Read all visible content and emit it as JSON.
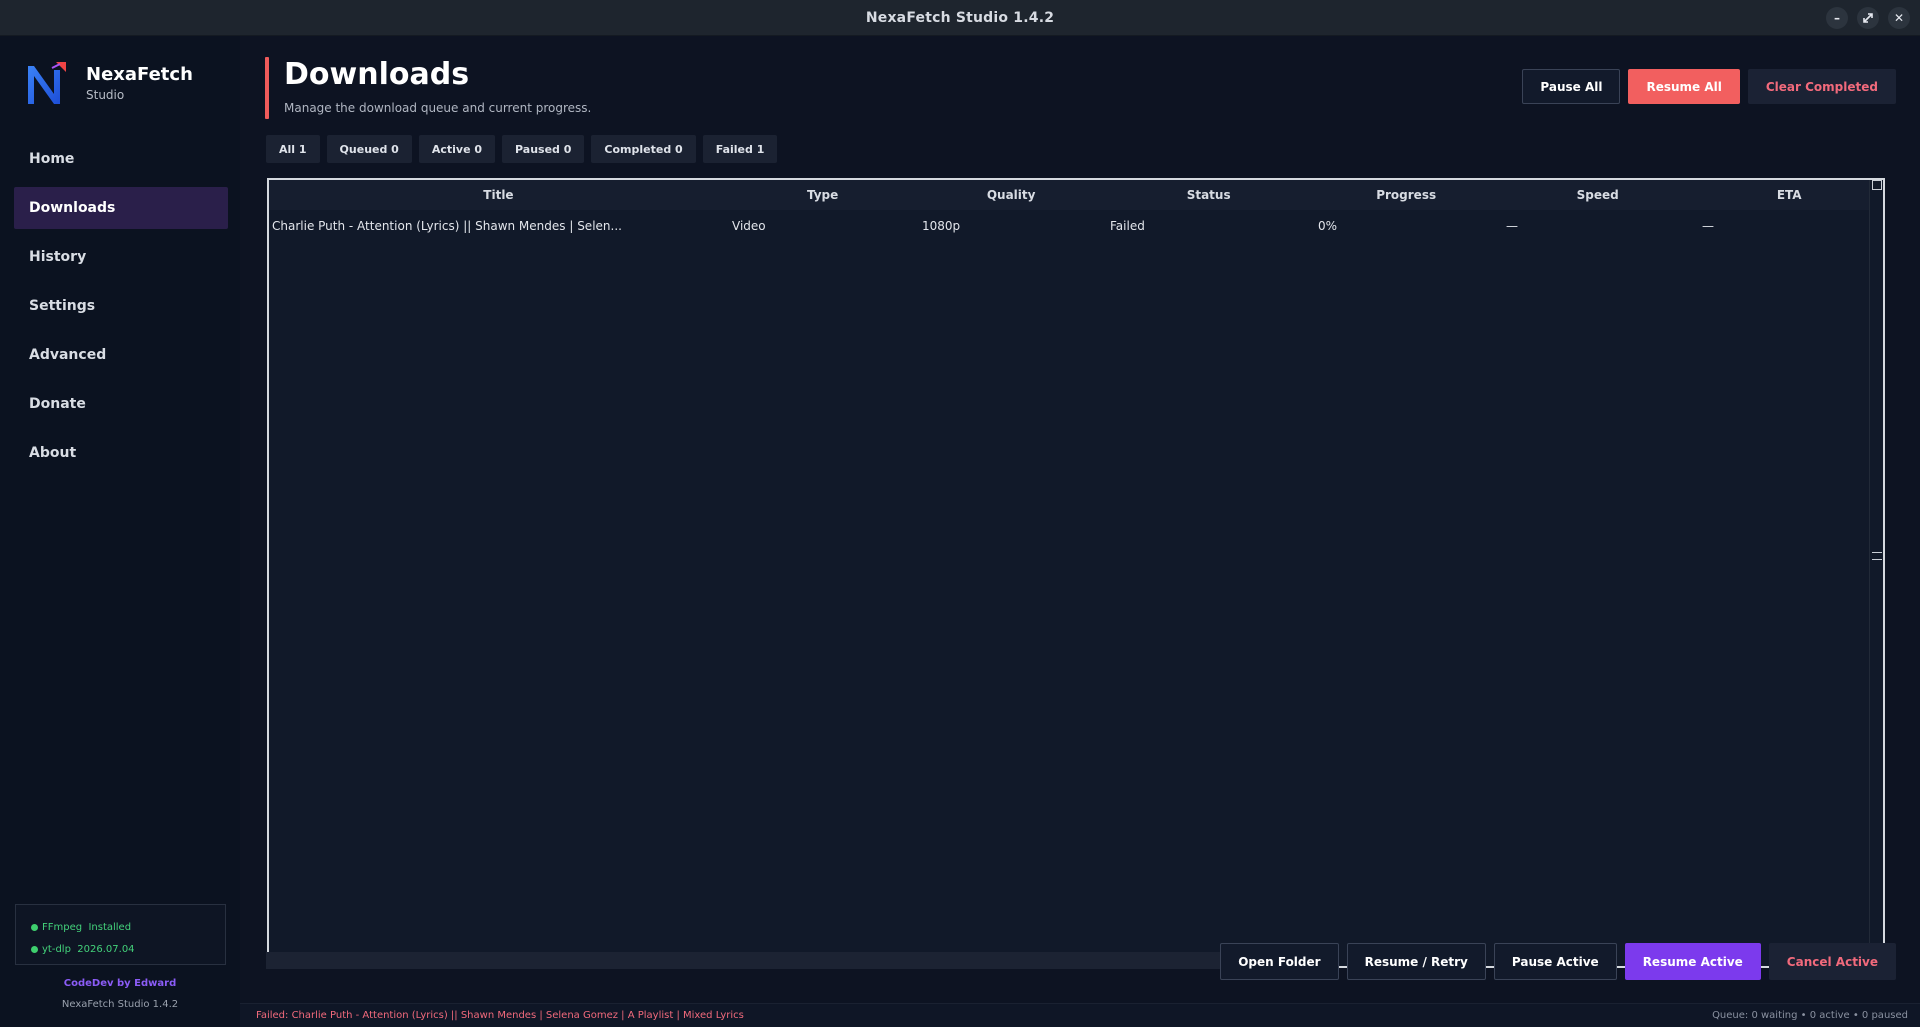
{
  "window": {
    "title": "NexaFetch Studio 1.4.2"
  },
  "sidebar": {
    "brand_name": "NexaFetch",
    "brand_sub": "Studio",
    "items": [
      {
        "label": "Home",
        "active": false
      },
      {
        "label": "Downloads",
        "active": true
      },
      {
        "label": "History",
        "active": false
      },
      {
        "label": "Settings",
        "active": false
      },
      {
        "label": "Advanced",
        "active": false
      },
      {
        "label": "Donate",
        "active": false
      },
      {
        "label": "About",
        "active": false
      }
    ],
    "deps": [
      {
        "name": "FFmpeg",
        "value": "Installed"
      },
      {
        "name": "yt-dlp",
        "value": "2026.07.04"
      }
    ],
    "credit": "CodeDev by Edward",
    "version": "NexaFetch Studio 1.4.2"
  },
  "header": {
    "title": "Downloads",
    "subtitle": "Manage the download queue and current progress.",
    "pause_all": "Pause All",
    "resume_all": "Resume All",
    "clear_completed": "Clear Completed"
  },
  "filters": [
    {
      "label": "All 1"
    },
    {
      "label": "Queued 0"
    },
    {
      "label": "Active 0"
    },
    {
      "label": "Paused 0"
    },
    {
      "label": "Completed 0"
    },
    {
      "label": "Failed 1"
    }
  ],
  "table": {
    "columns": [
      "Title",
      "Type",
      "Quality",
      "Status",
      "Progress",
      "Speed",
      "ETA"
    ],
    "rows": [
      {
        "title": "Charlie Puth - Attention (Lyrics) || Shawn Mendes | Selen...",
        "type": "Video",
        "quality": "1080p",
        "status": "Failed",
        "progress": "0%",
        "speed": "—",
        "eta": "—"
      }
    ]
  },
  "overall_progress": 0,
  "bottom": {
    "open_folder": "Open Folder",
    "resume_retry": "Resume / Retry",
    "pause_active": "Pause Active",
    "resume_active": "Resume Active",
    "cancel_active": "Cancel Active"
  },
  "statusbar": {
    "message": "Failed: Charlie Puth - Attention (Lyrics) || Shawn Mendes | Selena Gomez | A Playlist | Mixed Lyrics",
    "queue": "Queue: 0 waiting • 0 active • 0 paused"
  },
  "colors": {
    "accent_red": "#f25f5f",
    "accent_purple": "#7c3aed",
    "success_green": "#3ecf6e"
  }
}
